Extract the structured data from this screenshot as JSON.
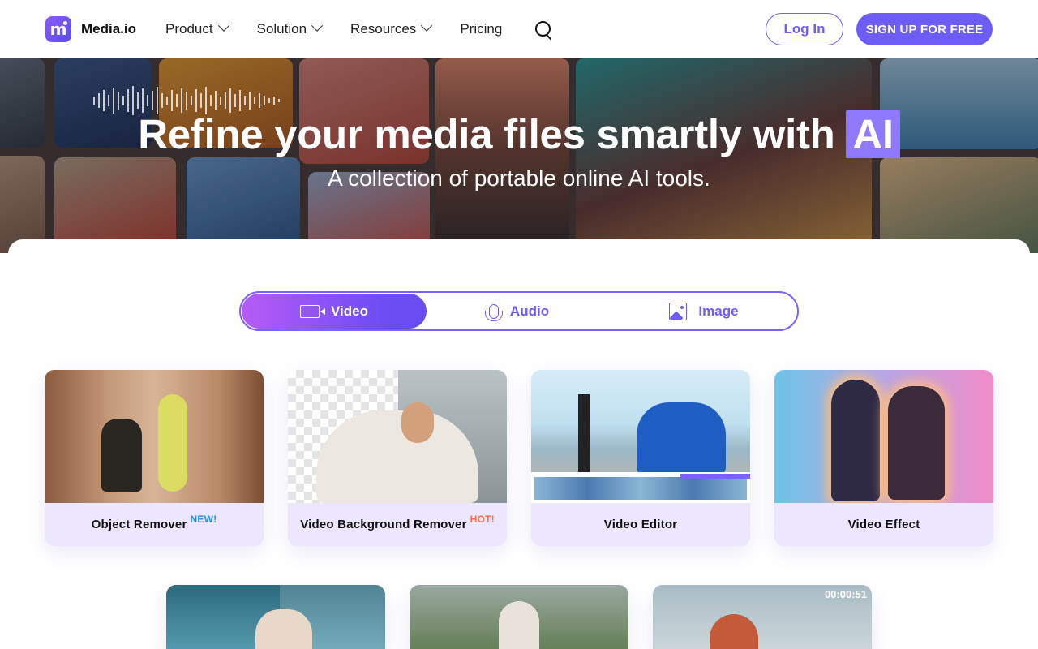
{
  "nav": {
    "logo_text": "Media.io",
    "logo_glyph": "m",
    "items": [
      {
        "label": "Product",
        "has_dropdown": true
      },
      {
        "label": "Solution",
        "has_dropdown": true
      },
      {
        "label": "Resources",
        "has_dropdown": true
      },
      {
        "label": "Pricing",
        "has_dropdown": false
      }
    ],
    "search_icon": "search-icon",
    "login_label": "Log In",
    "signup_label": "SIGN UP FOR FREE"
  },
  "hero": {
    "title_main": "Refine your media files smartly with ",
    "title_highlight": "AI",
    "subtitle": "A collection of portable online AI tools."
  },
  "tabs": [
    {
      "label": "Video",
      "icon": "video-icon",
      "active": true
    },
    {
      "label": "Audio",
      "icon": "microphone-icon",
      "active": false
    },
    {
      "label": "Image",
      "icon": "image-icon",
      "active": false
    }
  ],
  "cards": [
    {
      "title": "Object Remover",
      "badge": "NEW!"
    },
    {
      "title": "Video Background Remover",
      "badge": "HOT!"
    },
    {
      "title": "Video Editor",
      "badge": ""
    },
    {
      "title": "Video Effect",
      "badge": ""
    }
  ],
  "second_row": {
    "timestamp": "00:00:51"
  },
  "colors": {
    "accent": "#6d5cf5",
    "badge_new": "#1e8ee8",
    "badge_hot": "#ff6b3d",
    "card_label_bg": "#ece6ff"
  }
}
